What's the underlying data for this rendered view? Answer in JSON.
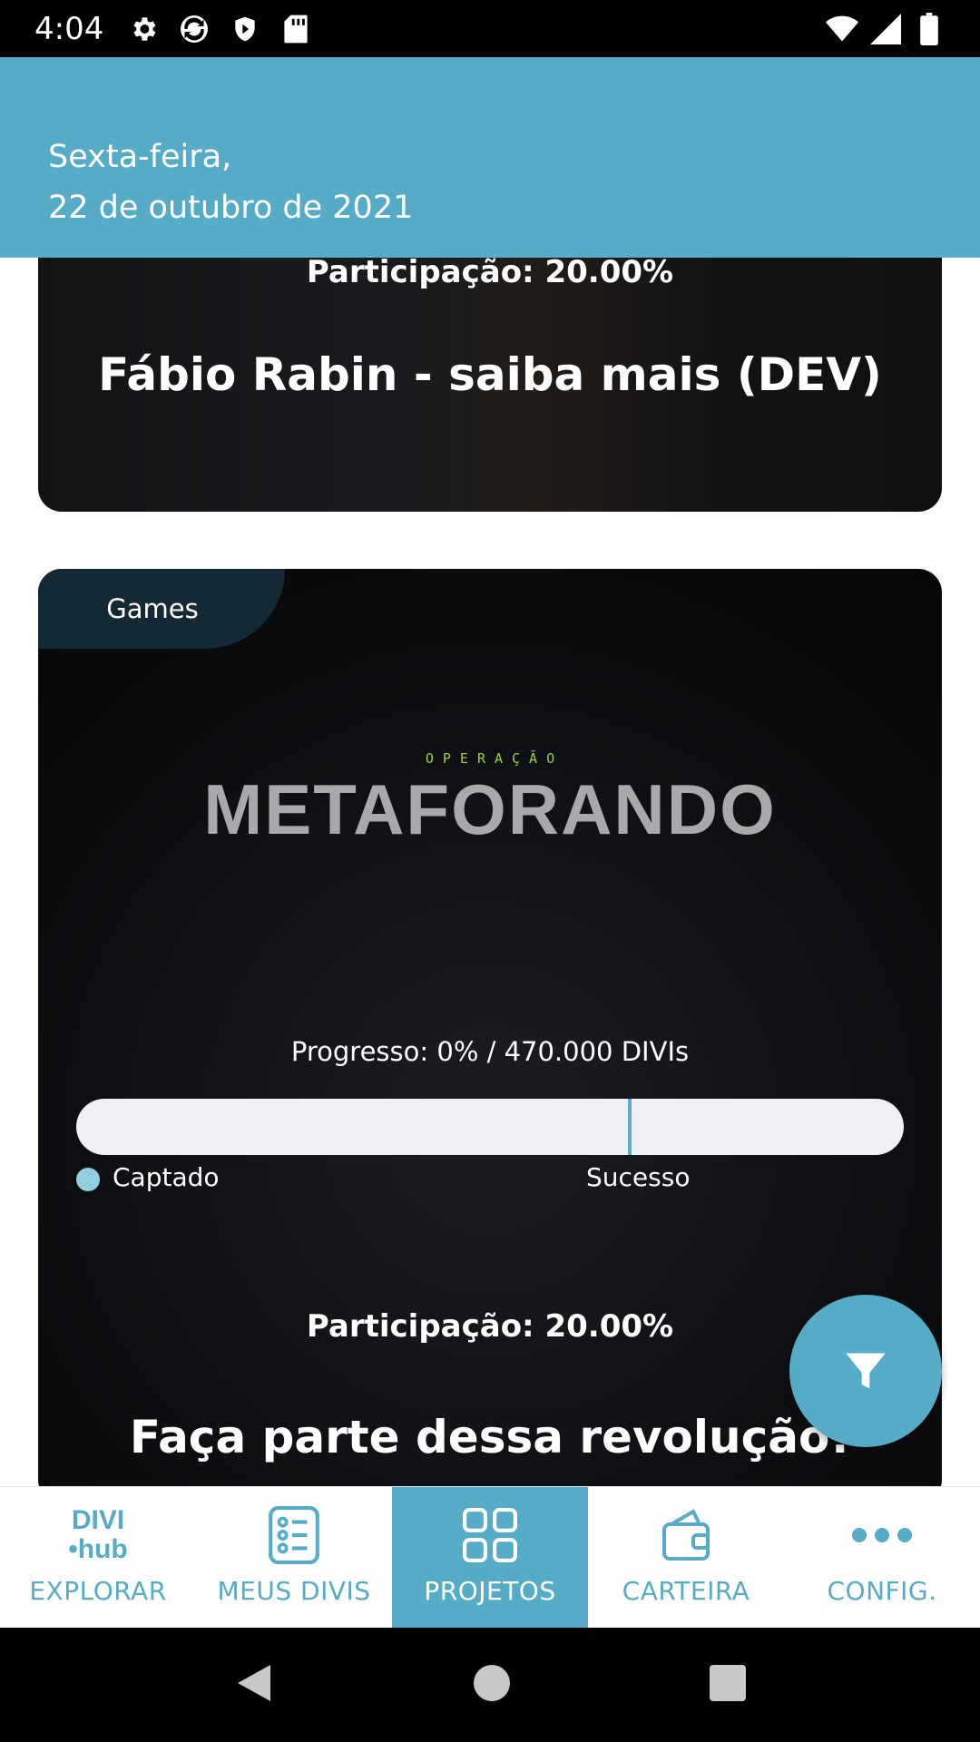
{
  "status_bar": {
    "time": "4:04"
  },
  "header": {
    "date_line1": "Sexta-feira,",
    "date_line2": "22 de outubro de 2021"
  },
  "cards": [
    {
      "participation": "Participação: 20.00%",
      "title": "Fábio Rabin - saiba mais (DEV)"
    },
    {
      "category": "Games",
      "banner_sub": "OPERAÇÃO",
      "banner_main": "METAFORANDO",
      "progress_label": "Progresso: 0% / 470.000 DIVIs",
      "progress_value_percent": 0,
      "legend_captado": "Captado",
      "legend_sucesso": "Sucesso",
      "participation": "Participação: 20.00%",
      "title": "Faça parte dessa revolução!"
    }
  ],
  "nav": {
    "logo_line1": "DIVI",
    "logo_line2": "•hub",
    "items": [
      {
        "label": "EXPLORAR"
      },
      {
        "label": "MEUS DIVIS"
      },
      {
        "label": "PROJETOS"
      },
      {
        "label": "CARTEIRA"
      },
      {
        "label": "CONFIG."
      }
    ]
  },
  "colors": {
    "accent": "#56abc6",
    "tag_bg": "#152935",
    "banner_green": "#9bd23a"
  }
}
